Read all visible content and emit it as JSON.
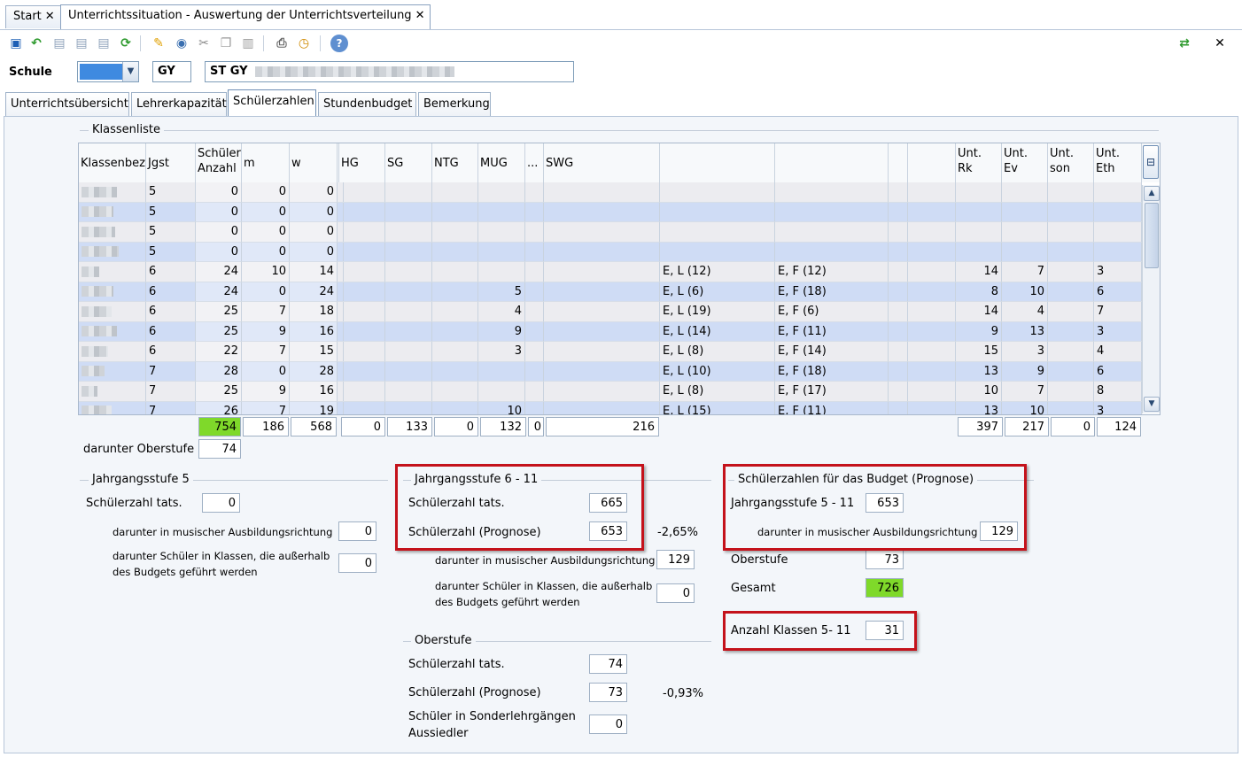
{
  "doc_tabs": [
    {
      "label": "Start"
    },
    {
      "label": "Unterrichtssituation - Auswertung der Unterrichtsverteilung"
    }
  ],
  "toolbar_icons": [
    "save-icon",
    "undo-icon",
    "copy-doc-icon",
    "paste-doc-icon",
    "new-doc-icon",
    "refresh-icon",
    "eraser-icon",
    "preview-icon",
    "cut-icon",
    "copy-icon",
    "paste-icon",
    "print-icon",
    "clock-icon",
    "help-icon"
  ],
  "header": {
    "schule_label": "Schule",
    "schulart": "GY",
    "school_name": "ST GY"
  },
  "section_tabs": [
    "Unterrichtsübersicht",
    "Lehrerkapazität",
    "Schülerzahlen",
    "Stundenbudget",
    "Bemerkung"
  ],
  "klassenliste": {
    "title": "Klassenliste",
    "columns": [
      "Klassenbez",
      "Jgst",
      "Schüler Anzahl",
      "m",
      "w",
      "HG",
      "SG",
      "NTG",
      "MUG",
      "...",
      "SWG",
      "",
      "",
      "",
      "",
      "Unt. Rk",
      "Unt. Ev",
      "Unt. son",
      "Unt. Eth"
    ],
    "rows": [
      {
        "jgst": "5",
        "anzahl": "0",
        "m": "0",
        "w": "0",
        "mug": "",
        "f1": "",
        "f2": "",
        "rk": "",
        "ev": "",
        "son": "",
        "eth": ""
      },
      {
        "jgst": "5",
        "anzahl": "0",
        "m": "0",
        "w": "0",
        "mug": "",
        "f1": "",
        "f2": "",
        "rk": "",
        "ev": "",
        "son": "",
        "eth": ""
      },
      {
        "jgst": "5",
        "anzahl": "0",
        "m": "0",
        "w": "0",
        "mug": "",
        "f1": "",
        "f2": "",
        "rk": "",
        "ev": "",
        "son": "",
        "eth": ""
      },
      {
        "jgst": "5",
        "anzahl": "0",
        "m": "0",
        "w": "0",
        "mug": "",
        "f1": "",
        "f2": "",
        "rk": "",
        "ev": "",
        "son": "",
        "eth": ""
      },
      {
        "jgst": "6",
        "anzahl": "24",
        "m": "10",
        "w": "14",
        "mug": "",
        "f1": "E, L (12)",
        "f2": "E, F (12)",
        "rk": "14",
        "ev": "7",
        "son": "",
        "eth": "3"
      },
      {
        "jgst": "6",
        "anzahl": "24",
        "m": "0",
        "w": "24",
        "mug": "5",
        "f1": "E, L (6)",
        "f2": "E, F (18)",
        "rk": "8",
        "ev": "10",
        "son": "",
        "eth": "6"
      },
      {
        "jgst": "6",
        "anzahl": "25",
        "m": "7",
        "w": "18",
        "mug": "4",
        "f1": "E, L (19)",
        "f2": "E, F (6)",
        "rk": "14",
        "ev": "4",
        "son": "",
        "eth": "7"
      },
      {
        "jgst": "6",
        "anzahl": "25",
        "m": "9",
        "w": "16",
        "mug": "9",
        "f1": "E, L (14)",
        "f2": "E, F (11)",
        "rk": "9",
        "ev": "13",
        "son": "",
        "eth": "3"
      },
      {
        "jgst": "6",
        "anzahl": "22",
        "m": "7",
        "w": "15",
        "mug": "3",
        "f1": "E, L (8)",
        "f2": "E, F (14)",
        "rk": "15",
        "ev": "3",
        "son": "",
        "eth": "4"
      },
      {
        "jgst": "7",
        "anzahl": "28",
        "m": "0",
        "w": "28",
        "mug": "",
        "f1": "E, L (10)",
        "f2": "E, F (18)",
        "rk": "13",
        "ev": "9",
        "son": "",
        "eth": "6"
      },
      {
        "jgst": "7",
        "anzahl": "25",
        "m": "9",
        "w": "16",
        "mug": "",
        "f1": "E, L (8)",
        "f2": "E, F (17)",
        "rk": "10",
        "ev": "7",
        "son": "",
        "eth": "8"
      },
      {
        "jgst": "7",
        "anzahl": "26",
        "m": "7",
        "w": "19",
        "mug": "10",
        "f1": "E, L (15)",
        "f2": "E, F (11)",
        "rk": "13",
        "ev": "10",
        "son": "",
        "eth": "3"
      }
    ],
    "totals": {
      "anzahl": "754",
      "m": "186",
      "w": "568",
      "hg": "0",
      "sg": "133",
      "ntg": "0",
      "mug": "132",
      "dots": "0",
      "swg": "216",
      "rk": "397",
      "ev": "217",
      "son": "0",
      "eth": "124"
    },
    "oberstufe_label": "darunter Oberstufe",
    "oberstufe_value": "74"
  },
  "jgst5": {
    "title": "Jahrgangsstufe 5",
    "tats_label": "Schülerzahl tats.",
    "tats_value": "0",
    "musisch_label": "darunter in musischer Ausbildungsrichtung",
    "musisch_value": "0",
    "ausserhalb_label1": "darunter Schüler in Klassen, die außerhalb",
    "ausserhalb_label2": "des Budgets geführt werden",
    "ausserhalb_value": "0"
  },
  "jgst611": {
    "title": "Jahrgangsstufe 6 - 11",
    "tats_label": "Schülerzahl tats.",
    "tats_value": "665",
    "prognose_label": "Schülerzahl (Prognose)",
    "prognose_value": "653",
    "percent": "-2,65%",
    "musisch_label": "darunter in musischer Ausbildungsrichtung",
    "musisch_value": "129",
    "ausserhalb_label1": "darunter Schüler in Klassen, die außerhalb",
    "ausserhalb_label2": "des Budgets geführt werden",
    "ausserhalb_value": "0"
  },
  "oberstufe": {
    "title": "Oberstufe",
    "tats_label": "Schülerzahl tats.",
    "tats_value": "74",
    "prognose_label": "Schülerzahl (Prognose)",
    "prognose_value": "73",
    "percent": "-0,93%",
    "sonder_label1": "Schüler in Sonderlehrgängen",
    "sonder_label2": "Aussiedler",
    "sonder_value": "0"
  },
  "budget": {
    "title": "Schülerzahlen für das Budget (Prognose)",
    "jgst_label": "Jahrgangsstufe 5 - 11",
    "jgst_value": "653",
    "musisch_label": "darunter in musischer Ausbildungsrichtung",
    "musisch_value": "129",
    "oberstufe_label": "Oberstufe",
    "oberstufe_value": "73",
    "gesamt_label": "Gesamt",
    "gesamt_value": "726",
    "klassen_label": "Anzahl Klassen 5- 11",
    "klassen_value": "31"
  },
  "colors": {
    "highlight_green": "#7fd92a",
    "annotation_red": "#c4121b",
    "row_blue": "#cfdcf5"
  }
}
